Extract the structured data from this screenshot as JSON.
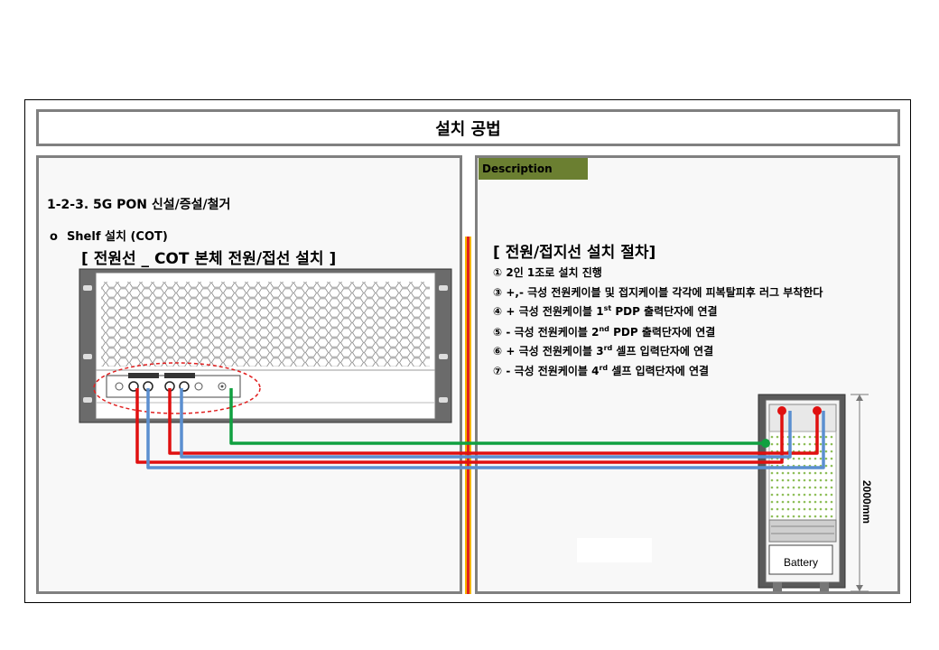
{
  "title": "설치 공법",
  "left": {
    "section_heading": "1-2-3. 5G PON 신설/증설/철거",
    "bullet_marker": "o",
    "bullet_text": "Shelf 설치 (COT)",
    "sub_heading": "[ 전원선  _ COT 본체 전원/접선 설치 ]"
  },
  "right": {
    "badge": "Description",
    "proc_title": "[ 전원/접지선 설치 절차]",
    "steps": [
      {
        "pre": "① 2인 1조로 설치 진행",
        "sup": "",
        "post": ""
      },
      {
        "pre": "③ +,- 극성 전원케이블 및 접지케이블 각각에 피복탈피후 러그 부착한다",
        "sup": "",
        "post": ""
      },
      {
        "pre": "④ + 극성 전원케이블 1",
        "sup": "st",
        "post": " PDP 출력단자에 연결"
      },
      {
        "pre": "⑤ - 극성 전원케이블 2",
        "sup": "nd",
        "post": " PDP 출력단자에 연결"
      },
      {
        "pre": "⑥ + 극성 전원케이블 3",
        "sup": "rd",
        "post": " 셀프 입력단자에 연결"
      },
      {
        "pre": "⑦ - 극성 전원케이블 4",
        "sup": "rd",
        "post": " 셀프 입력단자에 연결"
      }
    ],
    "rack_height_label": "2000mm",
    "battery_label": "Battery"
  },
  "colors": {
    "panel_border": "#808080",
    "badge_bg": "#6b7f31",
    "divider_outer": "#f6b400",
    "divider_inner": "#e02020",
    "cable_red": "#e01010",
    "cable_blue": "#5b8fd0",
    "cable_green": "#10a040"
  }
}
